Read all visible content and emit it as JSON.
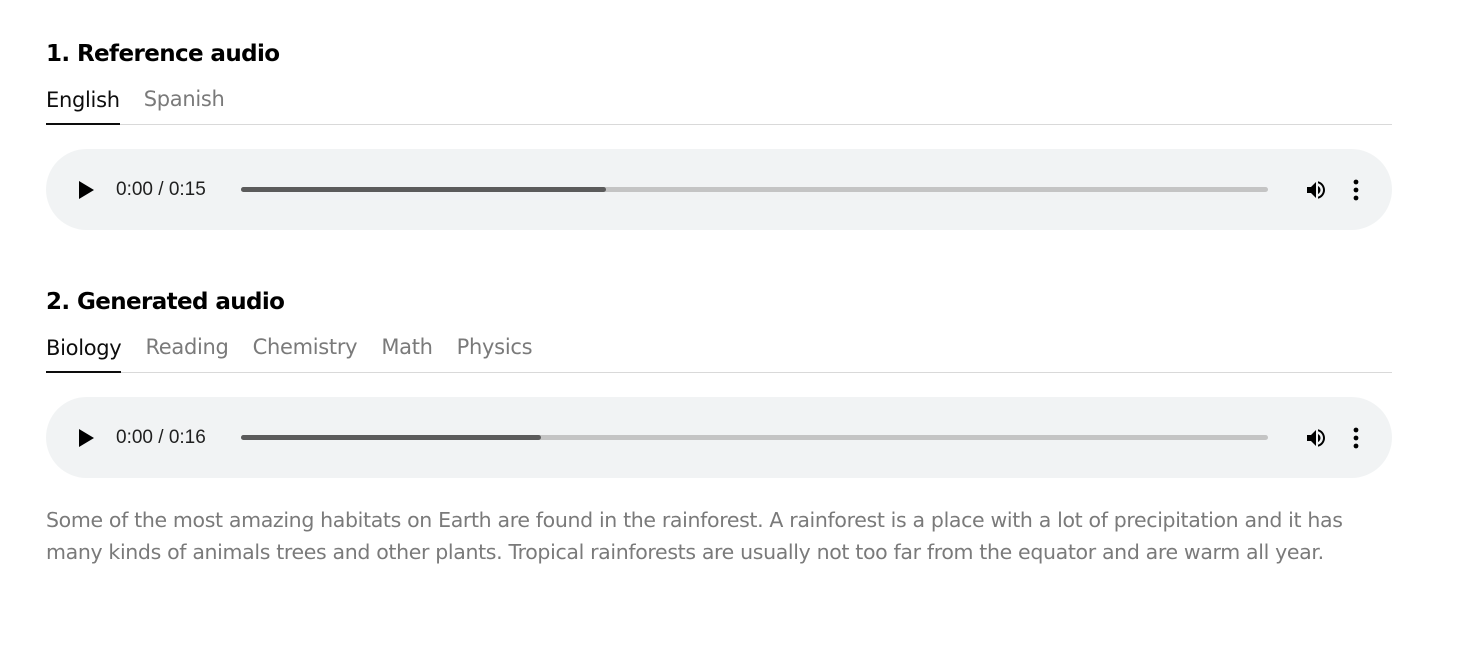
{
  "reference": {
    "title": "1. Reference audio",
    "tabs": [
      {
        "label": "English",
        "active": true
      },
      {
        "label": "Spanish",
        "active": false
      }
    ],
    "player": {
      "time": "0:00 / 0:15",
      "progress_fraction": 0.355
    }
  },
  "generated": {
    "title": "2. Generated audio",
    "tabs": [
      {
        "label": "Biology",
        "active": true
      },
      {
        "label": "Reading",
        "active": false
      },
      {
        "label": "Chemistry",
        "active": false
      },
      {
        "label": "Math",
        "active": false
      },
      {
        "label": "Physics",
        "active": false
      }
    ],
    "player": {
      "time": "0:00 / 0:16",
      "progress_fraction": 0.292
    },
    "description": "Some of the most amazing habitats on Earth are found in the rainforest. A rainforest is a place with a lot of precipitation and it has many kinds of animals trees and other plants. Tropical rainforests are usually not too far from the equator and are warm all year."
  },
  "icons": {
    "play": "play-icon",
    "volume": "volume-icon",
    "menu": "more-vert-icon"
  },
  "colors": {
    "player_bg": "#f1f3f4",
    "progress_fill": "#5b5b5b",
    "progress_track": "#c4c4c4",
    "active_tab": "#0d0d0d",
    "inactive_tab": "#7a7a7a"
  }
}
